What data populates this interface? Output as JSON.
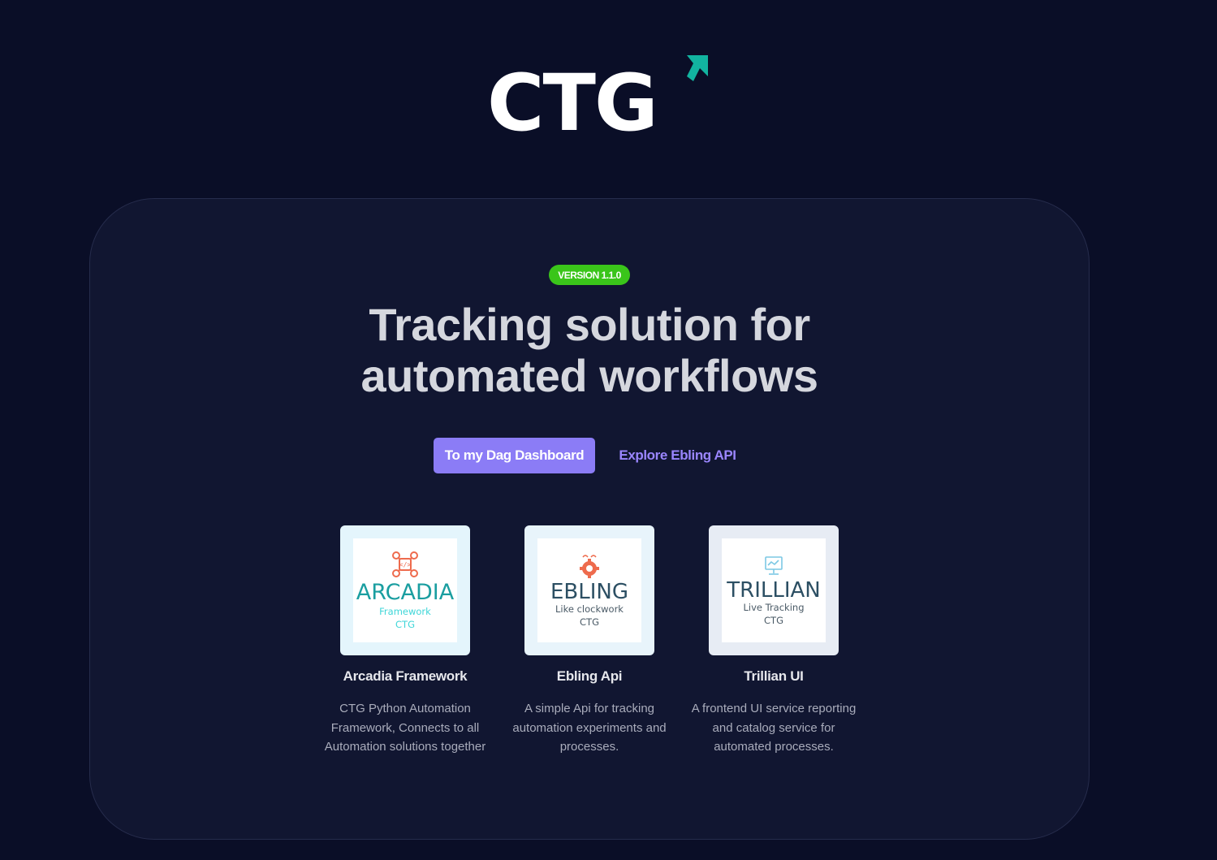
{
  "brand": {
    "logo_text": "CTG",
    "accent_color": "#12b3a0"
  },
  "hero": {
    "version_badge": "VERSION 1.1.0",
    "title_line1": "Tracking solution for",
    "title_line2": "automated workflows",
    "primary_button": "To my Dag Dashboard",
    "secondary_link": "Explore Ebling API"
  },
  "features": [
    {
      "title": "Arcadia Framework",
      "description": "CTG Python Automation Framework, Connects to all Automation solutions together",
      "logo_word": "ARCADIA",
      "logo_sub1": "Framework",
      "logo_sub2": "CTG",
      "icon": "network-code-icon",
      "frame_color": "#e4f5fc"
    },
    {
      "title": "Ebling Api",
      "description": "A simple Api for tracking automation experiments and processes.",
      "logo_word": "EBLING",
      "logo_sub1": "Like clockwork",
      "logo_sub2": "CTG",
      "icon": "gear-brain-icon",
      "frame_color": "#e8f4fb"
    },
    {
      "title": "Trillian UI",
      "description": "A frontend UI service reporting and catalog service for automated processes.",
      "logo_word": "TRILLIAN",
      "logo_sub1": "Live Tracking",
      "logo_sub2": "CTG",
      "icon": "monitor-icon",
      "frame_color": "#e7ecf4"
    }
  ]
}
